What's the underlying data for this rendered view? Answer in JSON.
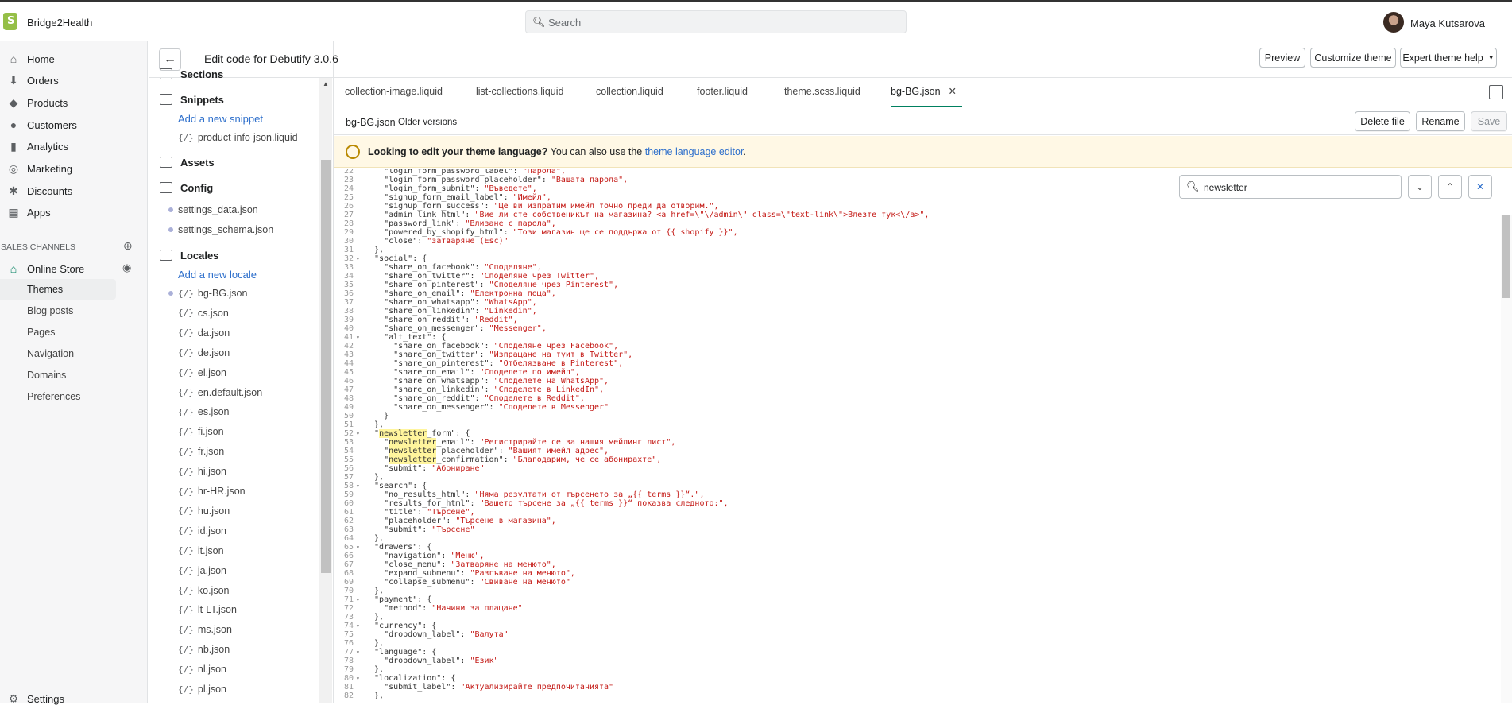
{
  "topbar": {
    "store_name": "Bridge2Health",
    "search_placeholder": "Search",
    "user_name": "Maya Kutsarova"
  },
  "nav": {
    "items": [
      {
        "label": "Home",
        "icon": "home-icon"
      },
      {
        "label": "Orders",
        "icon": "orders-icon"
      },
      {
        "label": "Products",
        "icon": "tag-icon"
      },
      {
        "label": "Customers",
        "icon": "person-icon"
      },
      {
        "label": "Analytics",
        "icon": "bar-chart-icon"
      },
      {
        "label": "Marketing",
        "icon": "target-icon"
      },
      {
        "label": "Discounts",
        "icon": "discount-icon"
      },
      {
        "label": "Apps",
        "icon": "apps-icon"
      }
    ],
    "sales_channels_label": "SALES CHANNELS",
    "online_store_label": "Online Store",
    "online_store_sub": [
      "Themes",
      "Blog posts",
      "Pages",
      "Navigation",
      "Domains",
      "Preferences"
    ],
    "settings_label": "Settings"
  },
  "header": {
    "back_label": "←",
    "edit_code_prefix": "Edit code for",
    "theme_name": "Debutify 3.0.6",
    "preview_label": "Preview",
    "customize_label": "Customize theme",
    "expert_label": "Expert theme help"
  },
  "tree": {
    "sections_label": "Sections",
    "snippets_label": "Snippets",
    "add_snippet_label": "Add a new snippet",
    "snippet_files": [
      "product-info-json.liquid"
    ],
    "assets_label": "Assets",
    "config_label": "Config",
    "config_files": [
      "settings_data.json",
      "settings_schema.json"
    ],
    "locales_label": "Locales",
    "add_locale_label": "Add a new locale",
    "locale_files": [
      "bg-BG.json",
      "cs.json",
      "da.json",
      "de.json",
      "el.json",
      "en.default.json",
      "es.json",
      "fi.json",
      "fr.json",
      "hi.json",
      "hr-HR.json",
      "hu.json",
      "id.json",
      "it.json",
      "ja.json",
      "ko.json",
      "lt-LT.json",
      "ms.json",
      "nb.json",
      "nl.json",
      "pl.json"
    ],
    "file_icon": "{/}"
  },
  "tabs": [
    "collection-image.liquid",
    "list-collections.liquid",
    "collection.liquid",
    "footer.liquid",
    "theme.scss.liquid",
    "bg-BG.json"
  ],
  "fileinfo": {
    "file_name": "bg-BG.json",
    "older_versions_label": "Older versions",
    "delete_label": "Delete file",
    "rename_label": "Rename",
    "save_label": "Save"
  },
  "banner": {
    "bold_text": "Looking to edit your theme language?",
    "text": " You can also use the ",
    "link_text": "theme language editor",
    "end": "."
  },
  "find": {
    "value": "newsletter"
  },
  "code_lines": [
    [
      "22",
      "    \"login_form_password_label\": ",
      "\"Парола\",",
      ""
    ],
    [
      "23",
      "    \"login_form_password_placeholder\": ",
      "\"Вашата парола\",",
      ""
    ],
    [
      "24",
      "    \"login_form_submit\": ",
      "\"Въведете\",",
      ""
    ],
    [
      "25",
      "    \"signup_form_email_label\": ",
      "\"Имейл\",",
      ""
    ],
    [
      "26",
      "    \"signup_form_success\": ",
      "\"Ще ви изпратим имейл точно преди да отворим.\",",
      ""
    ],
    [
      "27",
      "    \"admin_link_html\": ",
      "\"Вие ли сте собственикът на магазина? <a href=\\\"\\/admin\\\" class=\\\"text-link\\\">Влезте тук<\\/a>\",",
      ""
    ],
    [
      "28",
      "    \"password_link\": ",
      "\"Влизане с парола\",",
      ""
    ],
    [
      "29",
      "    \"powered_by_shopify_html\": ",
      "\"Този магазин ще се поддържа от {{ shopify }}\",",
      ""
    ],
    [
      "30",
      "    \"close\": ",
      "\"затваряне (Esc)\"",
      ""
    ],
    [
      "31",
      "  },",
      "",
      ""
    ],
    [
      "32",
      "  \"social\": {",
      "",
      "f"
    ],
    [
      "33",
      "    \"share_on_facebook\": ",
      "\"Споделяне\",",
      ""
    ],
    [
      "34",
      "    \"share_on_twitter\": ",
      "\"Споделяне чрез Twitter\",",
      ""
    ],
    [
      "35",
      "    \"share_on_pinterest\": ",
      "\"Споделяне чрез Pinterest\",",
      ""
    ],
    [
      "36",
      "    \"share_on_email\": ",
      "\"Електронна поща\",",
      ""
    ],
    [
      "37",
      "    \"share_on_whatsapp\": ",
      "\"WhatsApp\",",
      ""
    ],
    [
      "38",
      "    \"share_on_linkedin\": ",
      "\"Linkedin\",",
      ""
    ],
    [
      "39",
      "    \"share_on_reddit\": ",
      "\"Reddit\",",
      ""
    ],
    [
      "40",
      "    \"share_on_messenger\": ",
      "\"Messenger\",",
      ""
    ],
    [
      "41",
      "    \"alt_text\": {",
      "",
      "f"
    ],
    [
      "42",
      "      \"share_on_facebook\": ",
      "\"Споделяне чрез Facebook\",",
      ""
    ],
    [
      "43",
      "      \"share_on_twitter\": ",
      "\"Изпращане на туит в Twitter\",",
      ""
    ],
    [
      "44",
      "      \"share_on_pinterest\": ",
      "\"Отбелязване в Pinterest\",",
      ""
    ],
    [
      "45",
      "      \"share_on_email\": ",
      "\"Споделете по имейл\",",
      ""
    ],
    [
      "46",
      "      \"share_on_whatsapp\": ",
      "\"Споделете на WhatsApp\",",
      ""
    ],
    [
      "47",
      "      \"share_on_linkedin\": ",
      "\"Споделете в LinkedIn\",",
      ""
    ],
    [
      "48",
      "      \"share_on_reddit\": ",
      "\"Споделете в Reddit\",",
      ""
    ],
    [
      "49",
      "      \"share_on_messenger\": ",
      "\"Споделете в Messenger\"",
      ""
    ],
    [
      "50",
      "    }",
      "",
      ""
    ],
    [
      "51",
      "  },",
      "",
      ""
    ],
    [
      "52",
      "  \"newsletter_form\": {",
      "",
      "fh"
    ],
    [
      "53",
      "    \"newsletter_email\": ",
      "\"Регистрирайте се за нашия мейлинг лист\",",
      "h"
    ],
    [
      "54",
      "    \"newsletter_placeholder\": ",
      "\"Вашият имейл адрес\",",
      "h"
    ],
    [
      "55",
      "    \"newsletter_confirmation\": ",
      "\"Благодарим, че се абонирахте\",",
      "h"
    ],
    [
      "56",
      "    \"submit\": ",
      "\"Абониране\"",
      ""
    ],
    [
      "57",
      "  },",
      "",
      ""
    ],
    [
      "58",
      "  \"search\": {",
      "",
      "f"
    ],
    [
      "59",
      "    \"no_results_html\": ",
      "\"Няма резултати от търсенето за „{{ terms }}“.\",",
      ""
    ],
    [
      "60",
      "    \"results_for_html\": ",
      "\"Вашето търсене за „{{ terms }}“ показва следното:\",",
      ""
    ],
    [
      "61",
      "    \"title\": ",
      "\"Търсене\",",
      ""
    ],
    [
      "62",
      "    \"placeholder\": ",
      "\"Търсене в магазина\",",
      ""
    ],
    [
      "63",
      "    \"submit\": ",
      "\"Търсене\"",
      ""
    ],
    [
      "64",
      "  },",
      "",
      ""
    ],
    [
      "65",
      "  \"drawers\": {",
      "",
      "f"
    ],
    [
      "66",
      "    \"navigation\": ",
      "\"Меню\",",
      ""
    ],
    [
      "67",
      "    \"close_menu\": ",
      "\"Затваряне на менюто\",",
      ""
    ],
    [
      "68",
      "    \"expand_submenu\": ",
      "\"Разгъване на менюто\",",
      ""
    ],
    [
      "69",
      "    \"collapse_submenu\": ",
      "\"Свиване на менюто\"",
      ""
    ],
    [
      "70",
      "  },",
      "",
      ""
    ],
    [
      "71",
      "  \"payment\": {",
      "",
      "f"
    ],
    [
      "72",
      "    \"method\": ",
      "\"Начини за плащане\"",
      ""
    ],
    [
      "73",
      "  },",
      "",
      ""
    ],
    [
      "74",
      "  \"currency\": {",
      "",
      "f"
    ],
    [
      "75",
      "    \"dropdown_label\": ",
      "\"Валута\"",
      ""
    ],
    [
      "76",
      "  },",
      "",
      ""
    ],
    [
      "77",
      "  \"language\": {",
      "",
      "f"
    ],
    [
      "78",
      "    \"dropdown_label\": ",
      "\"Език\"",
      ""
    ],
    [
      "79",
      "  },",
      "",
      ""
    ],
    [
      "80",
      "  \"localization\": {",
      "",
      "f"
    ],
    [
      "81",
      "    \"submit_label\": ",
      "\"Актуализирайте предпочитанията\"",
      ""
    ],
    [
      "82",
      "  },",
      "",
      ""
    ]
  ]
}
